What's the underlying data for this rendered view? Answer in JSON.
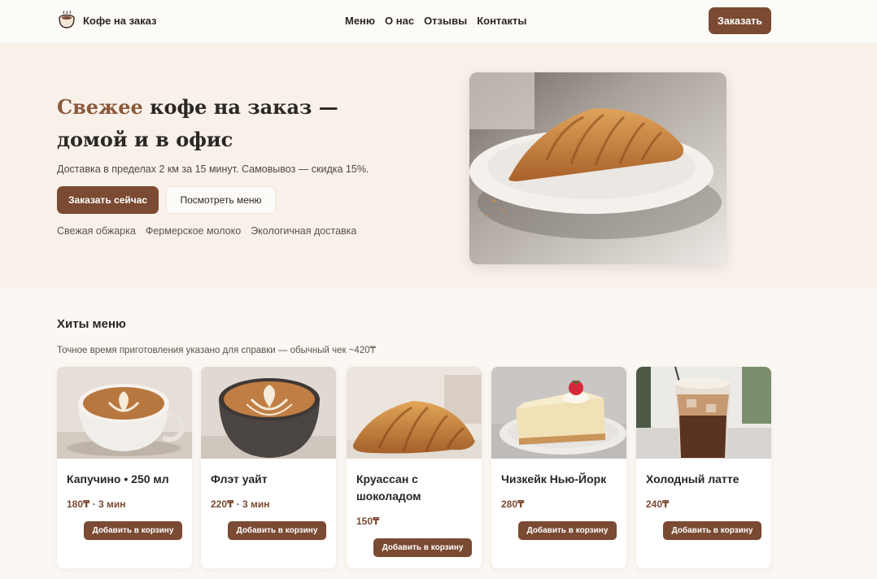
{
  "header": {
    "logo_icon": "coffee-cup-icon",
    "brand": "Кофе на заказ",
    "nav": [
      "Меню",
      "О нас",
      "Отзывы",
      "Контакты"
    ],
    "order_button": "Заказать"
  },
  "hero": {
    "title_accent": "Свежее",
    "title_rest": " кофе на заказ — домой и в офис",
    "subtitle": "Доставка в пределах 2 км за 15 минут. Самовывоз — скидка 15%.",
    "primary_button": "Заказать сейчас",
    "secondary_button": "Посмотреть меню",
    "features": [
      "Свежая обжарка",
      "Фермерское молоко",
      "Экологичная доставка"
    ],
    "image": "croissant-on-plate"
  },
  "menu": {
    "title": "Хиты меню",
    "subtitle": "Точное время приготовления указано для справки — обычный чек ~420₸",
    "items": [
      {
        "name": "Капучино • 250 мл",
        "price": "180₸ · 3 мин",
        "button": "Добавить в корзину",
        "image": "cappuccino-light-cup"
      },
      {
        "name": "Флэт уайт",
        "price": "220₸ · 3 мин",
        "button": "Добавить в корзину",
        "image": "flat-white-dark-cup"
      },
      {
        "name": "Круассан с шоколадом",
        "price": "150₸",
        "button": "Добавить в корзину",
        "image": "croissant"
      },
      {
        "name": "Чизкейк Нью-Йорк",
        "price": "280₸",
        "button": "Добавить в корзину",
        "image": "cheesecake-slice"
      },
      {
        "name": "Холодный латте",
        "price": "240₸",
        "button": "Добавить в корзину",
        "image": "iced-latte-glass"
      }
    ]
  },
  "colors": {
    "accent": "#7a4a32",
    "accent_text": "#8b5a3c",
    "page_bg": "#fbf7f2",
    "hero_bg": "#f8f1ea"
  }
}
